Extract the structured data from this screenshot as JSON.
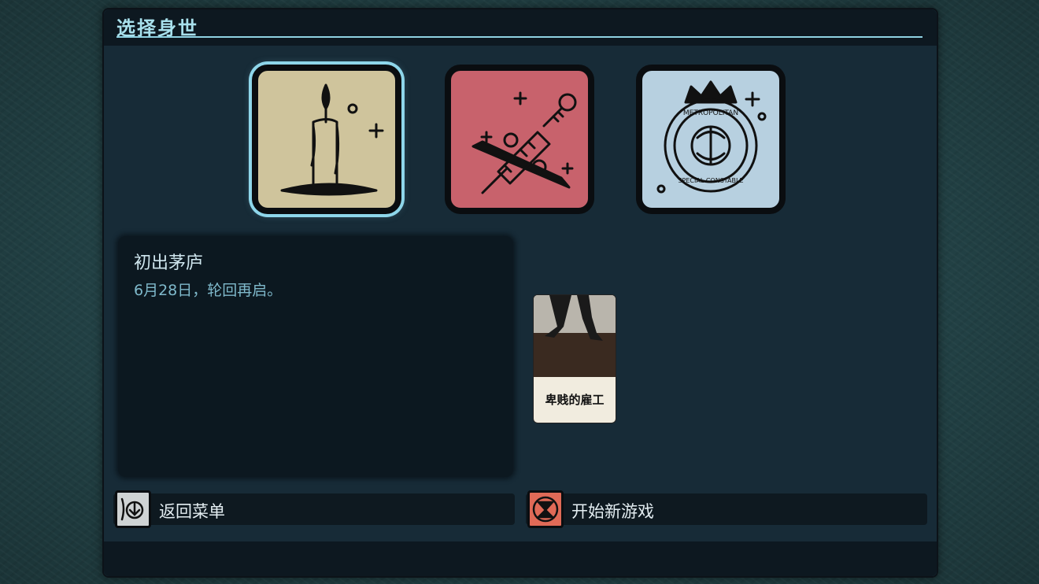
{
  "panel": {
    "title": "选择身世"
  },
  "origins": [
    {
      "id": "candle",
      "icon": "candle-icon",
      "selected": true
    },
    {
      "id": "syringe",
      "icon": "syringe-scalpel-icon",
      "selected": false
    },
    {
      "id": "badge",
      "icon": "metropolitan-badge-icon",
      "badge_text_top": "METROPOLITAN",
      "badge_text_bottom": "SPECIAL CONSTABLE",
      "selected": false
    }
  ],
  "description": {
    "title": "初出茅庐",
    "text": "6月28日，轮回再启。"
  },
  "skill_card": {
    "label": "卑贱的雇工",
    "art": "walking-legs-icon"
  },
  "buttons": {
    "back": {
      "label": "返回菜单",
      "icon": "back-arrow-icon"
    },
    "start": {
      "label": "开始新游戏",
      "icon": "hourglass-icon"
    }
  },
  "colors": {
    "accent": "#8ed6ea",
    "card_candle": "#cfc49c",
    "card_syringe": "#c8626c",
    "card_badge": "#b7d0e0",
    "start_icon": "#e06a57"
  }
}
